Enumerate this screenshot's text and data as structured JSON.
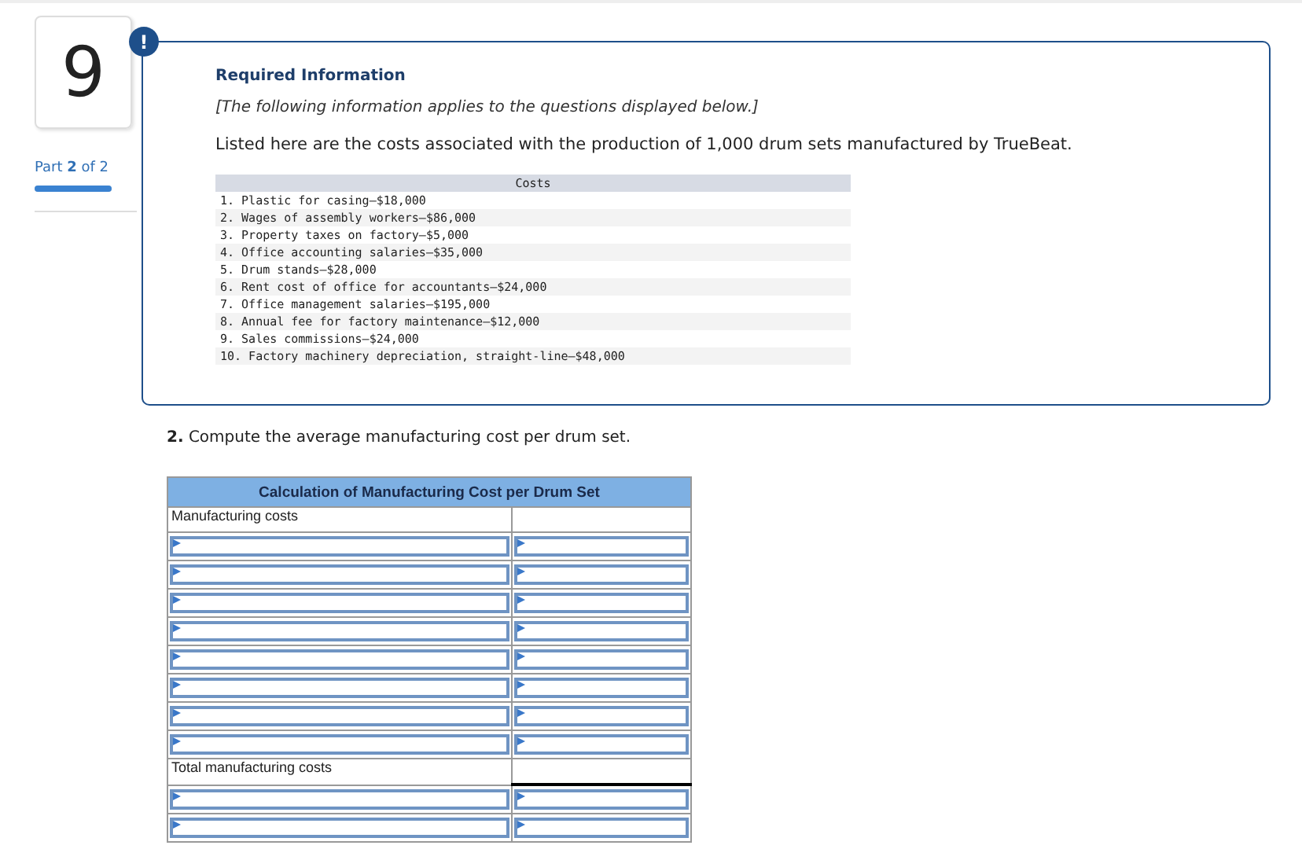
{
  "question_number": "9",
  "part": {
    "label": "Part **2** of 2",
    "level": 1
  },
  "alert_icon": "!",
  "info": {
    "title": "Required Information",
    "note": "[The following information applies to the questions displayed below.]",
    "intro": "Listed here are the costs associated with the production of 1,000 drum sets manufactured by TrueBeat.",
    "costs_header": "Costs",
    "costs": [
      "1. Plastic for casing—$18,000",
      "2. Wages of assembly workers—$86,000",
      "3. Property taxes on factory—$5,000",
      "4. Office accounting salaries—$35,000",
      "5. Drum stands—$28,000",
      "6. Rent cost of office for accountants—$24,000",
      "7. Office management salaries—$195,000",
      "8. Annual fee for factory maintenance—$12,000",
      "9. Sales commissions—$24,000",
      "10. Factory machinery depreciation, straight-line—$48,000"
    ]
  },
  "question": "**2.** Compute the average manufacturing cost per drum set.",
  "table": {
    "title": "Calculation of Manufacturing Cost per Drum Set",
    "rows": [
      {
        "kind": "label",
        "label": "Manufacturing costs"
      },
      {
        "kind": "input"
      },
      {
        "kind": "input"
      },
      {
        "kind": "input"
      },
      {
        "kind": "input"
      },
      {
        "kind": "input"
      },
      {
        "kind": "input"
      },
      {
        "kind": "input"
      },
      {
        "kind": "input"
      },
      {
        "kind": "total",
        "label": "Total manufacturing costs"
      },
      {
        "kind": "input"
      },
      {
        "kind": "input"
      }
    ]
  }
}
